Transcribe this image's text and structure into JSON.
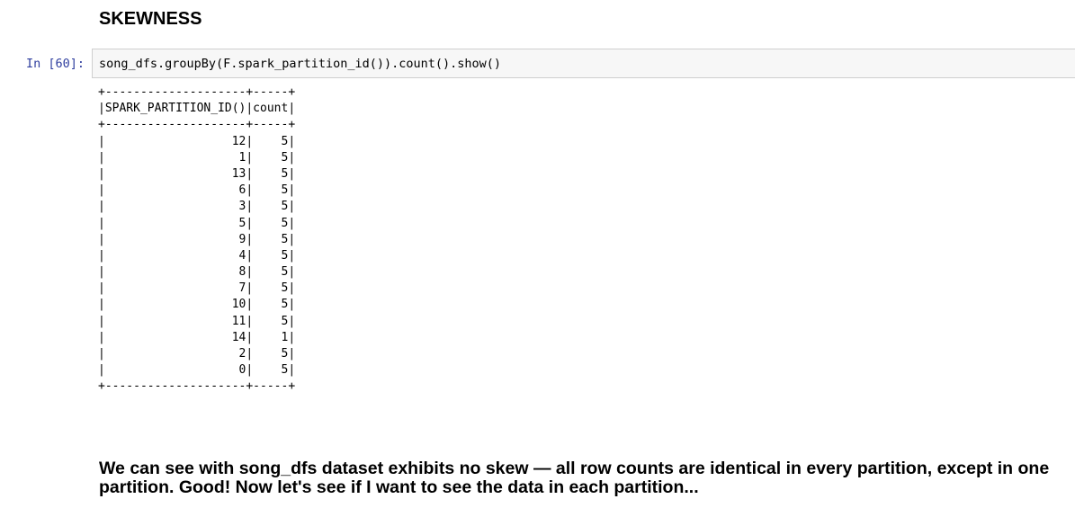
{
  "heading": "SKEWNESS",
  "cell": {
    "prompt": "In [60]:",
    "code": "song_dfs.groupBy(F.spark_partition_id()).count().show()"
  },
  "output": {
    "border_top": "+--------------------+-----+",
    "header": "|SPARK_PARTITION_ID()|count|",
    "border_mid": "+--------------------+-----+",
    "rows": [
      "|                  12|    5|",
      "|                   1|    5|",
      "|                  13|    5|",
      "|                   6|    5|",
      "|                   3|    5|",
      "|                   5|    5|",
      "|                   9|    5|",
      "|                   4|    5|",
      "|                   8|    5|",
      "|                   7|    5|",
      "|                  10|    5|",
      "|                  11|    5|",
      "|                  14|    1|",
      "|                   2|    5|",
      "|                   0|    5|"
    ],
    "border_bottom": "+--------------------+-----+"
  },
  "conclusion": "We can see with song_dfs dataset exhibits no skew — all row counts are identical in every partition, except in one partition. Good! Now let's see if I want to see the data in each partition..."
}
